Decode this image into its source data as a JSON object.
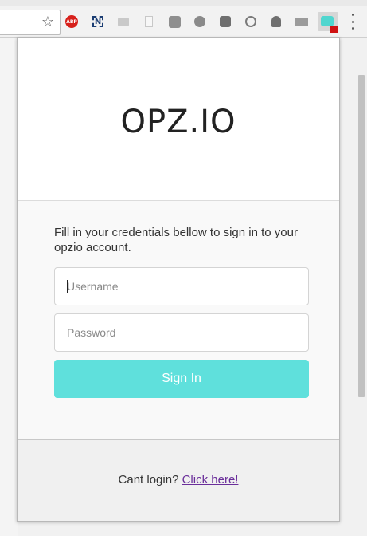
{
  "toolbar": {
    "bookmark_icon": "star-outline-icon",
    "extensions": [
      {
        "name": "adblock-plus",
        "label": "ABP",
        "color": "#d7201b"
      },
      {
        "name": "n-extension",
        "label": "N",
        "color": "#1b3d73"
      },
      {
        "name": "grey-extension-1",
        "color": "#c9c9c9"
      },
      {
        "name": "grey-document-extension",
        "color": "#c8c8c8"
      },
      {
        "name": "puzzle-extension",
        "color": "#8f8f8f"
      },
      {
        "name": "clock-extension",
        "color": "#8a8a8a"
      },
      {
        "name": "fish-extension",
        "color": "#6f6f6f"
      },
      {
        "name": "sync-extension",
        "color": "#7a7a7a"
      },
      {
        "name": "ghost-extension",
        "color": "#6f6f6f"
      },
      {
        "name": "laptop-extension",
        "color": "#9b9b9b"
      },
      {
        "name": "opzio-extension",
        "color": "#4fd6cf"
      }
    ],
    "menu_icon": "three-dots-vertical-icon"
  },
  "popup": {
    "logo": "OPZ.IO",
    "intro_text": "Fill in your credentials bellow to sign in to your opzio account.",
    "username": {
      "value": "",
      "placeholder": "Username"
    },
    "password": {
      "value": "",
      "placeholder": "Password"
    },
    "signin_label": "Sign In",
    "footer_prefix": "Cant login? ",
    "footer_link": "Click here!"
  },
  "colors": {
    "accent": "#5fe0dc",
    "link": "#6a2e9a",
    "footer_bg": "#f0f0f0"
  }
}
